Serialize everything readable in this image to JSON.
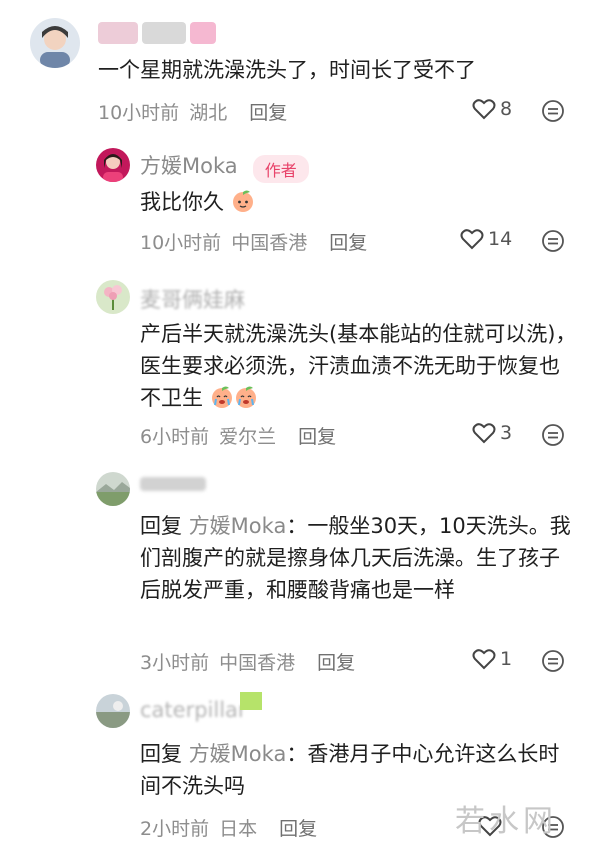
{
  "comments": [
    {
      "text": "一个星期就洗澡洗头了，时间长了受不了",
      "time": "10小时前",
      "location": "湖北",
      "reply_label": "回复",
      "likes": "8"
    },
    {
      "user": "方媛Moka",
      "badge": "作者",
      "text": "我比你久",
      "time": "10小时前",
      "location": "中国香港",
      "reply_label": "回复",
      "likes": "14"
    },
    {
      "user": "麦哥俩娃麻",
      "text": "产后半天就洗澡洗头(基本能站的住就可以洗)，医生要求必须洗，汗渍血渍不洗无助于恢复也不卫生",
      "time": "6小时前",
      "location": "爱尔兰",
      "reply_label": "回复",
      "likes": "3"
    },
    {
      "reply_prefix": "回复",
      "reply_to": "方媛Moka",
      "text": "：一般坐30天，10天洗头。我们剖腹产的就是擦身体几天后洗澡。生了孩子后脱发严重，和腰酸背痛也是一样",
      "time": "3小时前",
      "location": "中国香港",
      "reply_label": "回复",
      "likes": "1"
    },
    {
      "user": "caterpillar",
      "reply_prefix": "回复",
      "reply_to": "方媛Moka",
      "text": "：香港月子中心允许这么长时间不洗头吗",
      "time": "2小时前",
      "location": "日本",
      "reply_label": "回复"
    }
  ],
  "watermark": "若水网",
  "icons": {
    "like": "heart-icon",
    "more": "more-dots-icon"
  },
  "colors": {
    "author_badge_bg": "#fde7ec",
    "author_badge_text": "#e8436a"
  }
}
